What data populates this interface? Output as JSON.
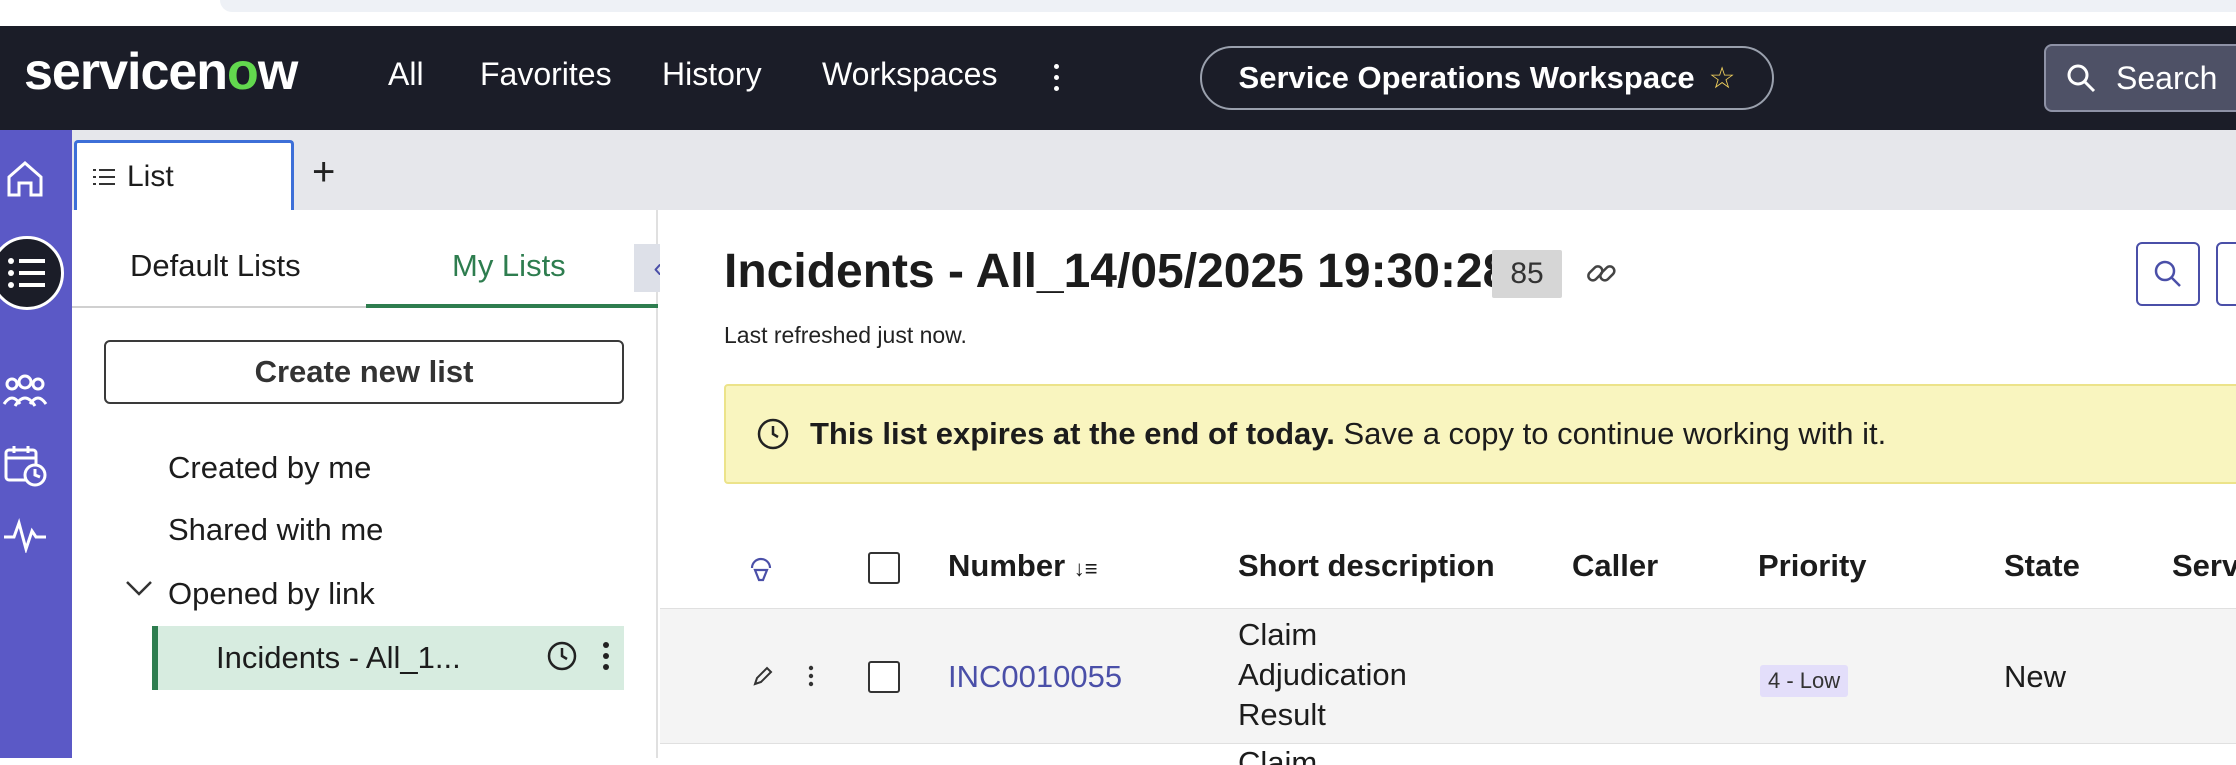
{
  "nav": {
    "logo_pre": "servicen",
    "logo_o": "o",
    "logo_post": "w",
    "items": [
      "All",
      "Favorites",
      "History",
      "Workspaces"
    ],
    "workspace": "Service Operations Workspace",
    "search": "Search"
  },
  "tabs": {
    "active": "List"
  },
  "list_panel": {
    "tab_default": "Default Lists",
    "tab_my": "My Lists",
    "create_button": "Create new list",
    "created_by_me": "Created by me",
    "shared_with_me": "Shared with me",
    "opened_by_link": "Opened by link",
    "selected_item": "Incidents - All_1..."
  },
  "main": {
    "title": "Incidents - All_14/05/2025 19:30:28",
    "count": "85",
    "refreshed": "Last refreshed just now.",
    "banner_bold": "This list expires at the end of today.",
    "banner_rest": "Save a copy to continue working with it."
  },
  "table": {
    "columns": {
      "number": "Number",
      "short_description": "Short description",
      "caller": "Caller",
      "priority": "Priority",
      "state": "State",
      "service": "Serv"
    },
    "rows": [
      {
        "number": "INC0010055",
        "desc_line1": "Claim",
        "desc_line2": "Adjudication",
        "desc_line3": "Result",
        "caller": "",
        "priority": "4 - Low",
        "state": "New"
      }
    ],
    "next_row_partial": "Claim"
  },
  "colors": {
    "nav_bg": "#1b1d28",
    "rail_bg": "#5b59c6",
    "accent_green": "#2e7d4f",
    "link_purple": "#4a4fa8",
    "banner_bg": "#f9f5bf"
  }
}
